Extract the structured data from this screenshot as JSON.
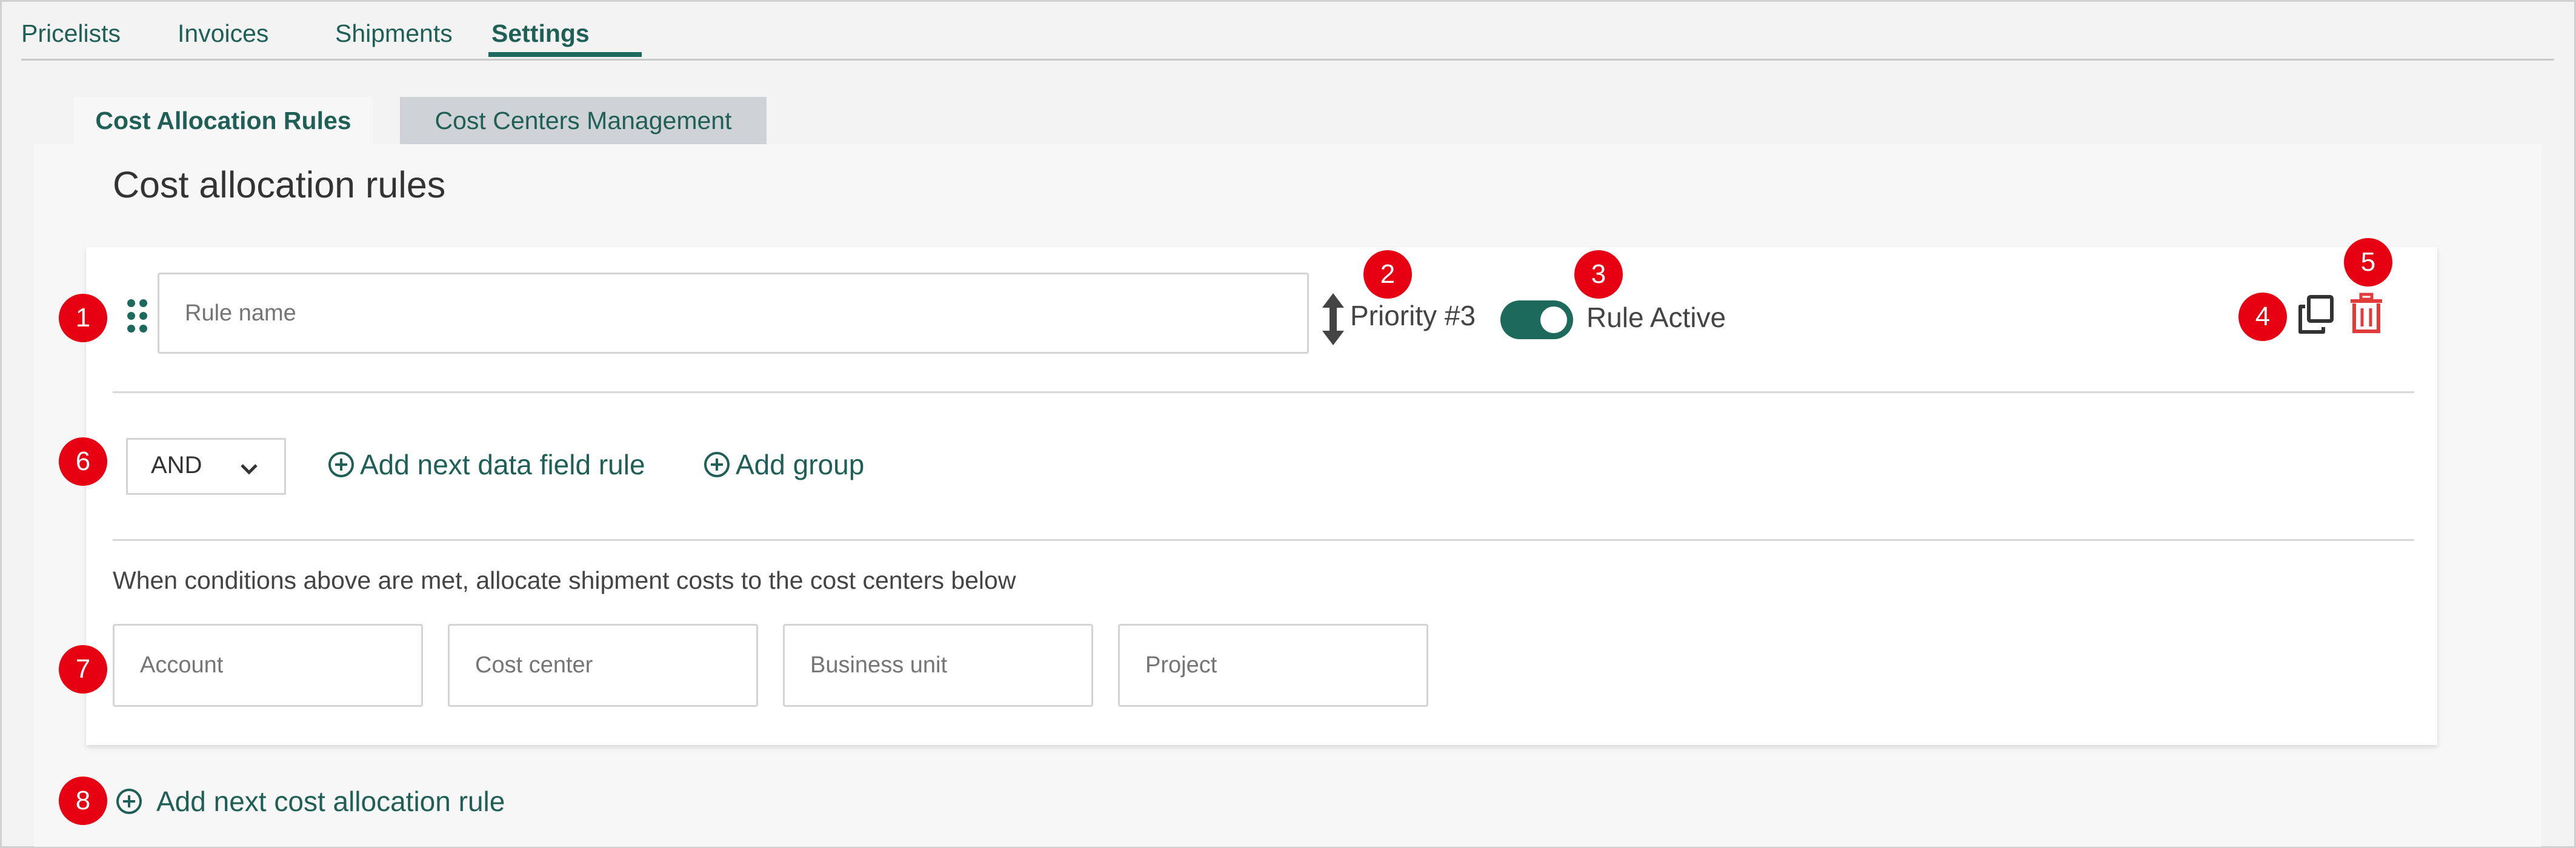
{
  "nav": {
    "tabs": [
      {
        "label": "Pricelists"
      },
      {
        "label": "Invoices"
      },
      {
        "label": "Shipments"
      },
      {
        "label": "Settings",
        "active": true
      }
    ]
  },
  "subtabs": [
    {
      "label": "Cost Allocation Rules",
      "active": true
    },
    {
      "label": "Cost Centers Management",
      "active": false
    }
  ],
  "page_title": "Cost allocation rules",
  "rule": {
    "name_placeholder": "Rule name",
    "name_value": "",
    "priority_label": "Priority #3",
    "active": true,
    "active_label": "Rule Active",
    "operator_value": "AND",
    "add_field_rule_label": "Add next data field rule",
    "add_group_label": "Add group",
    "allocation_text": "When conditions above are met, allocate shipment costs to the cost centers below",
    "allocation_fields": [
      {
        "placeholder": "Account"
      },
      {
        "placeholder": "Cost center"
      },
      {
        "placeholder": "Business unit"
      },
      {
        "placeholder": "Project"
      }
    ]
  },
  "add_rule_label": "Add next cost allocation rule",
  "annotations": [
    "1",
    "2",
    "3",
    "4",
    "5",
    "6",
    "7",
    "8"
  ],
  "colors": {
    "accent": "#1d6a5c",
    "badge": "#e60012",
    "delete": "#e23b3b",
    "inactive_tab": "#cfd3d8"
  }
}
